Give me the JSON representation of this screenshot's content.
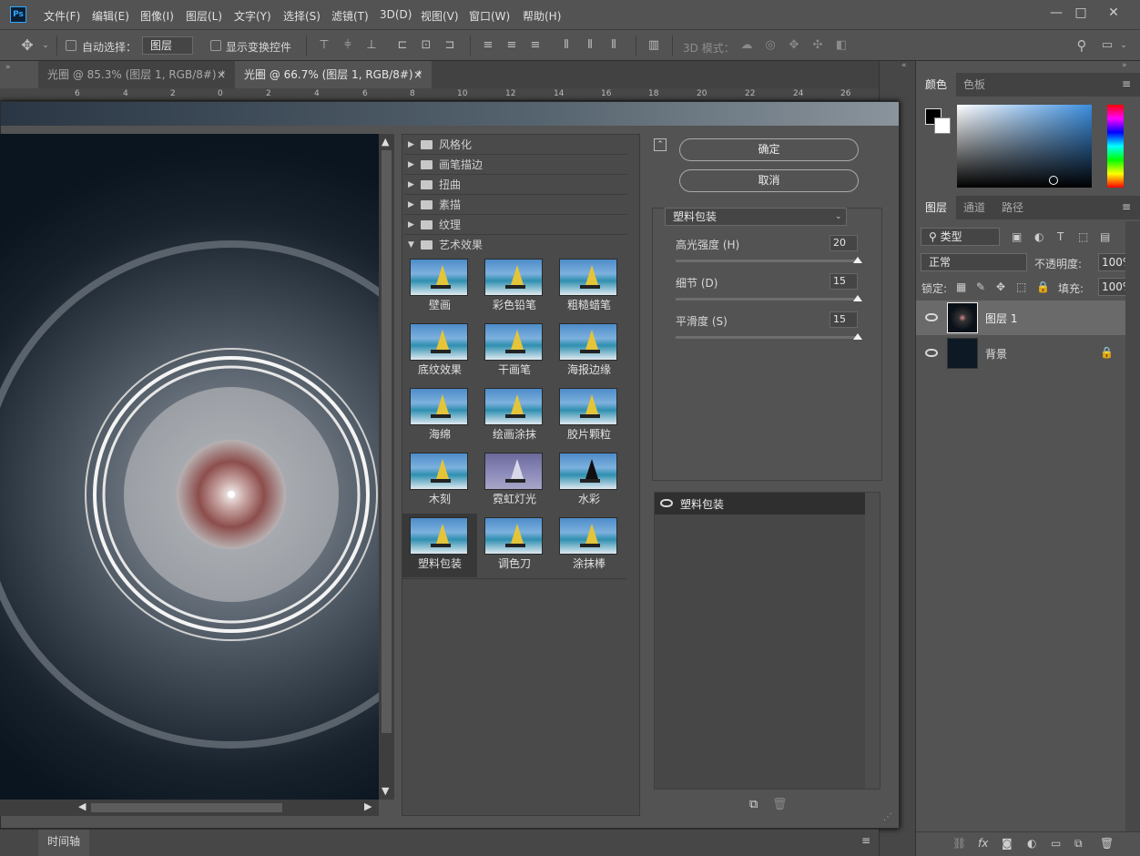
{
  "app": {
    "logo": "Ps"
  },
  "menu": [
    "文件(F)",
    "编辑(E)",
    "图像(I)",
    "图层(L)",
    "文字(Y)",
    "选择(S)",
    "滤镜(T)",
    "3D(D)",
    "视图(V)",
    "窗口(W)",
    "帮助(H)"
  ],
  "window_controls": {
    "minimize": "—",
    "restore": "□",
    "close": "✕"
  },
  "options": {
    "auto_select_label": "自动选择：",
    "auto_select_value": "图层",
    "show_transform_label": "显示变换控件",
    "mode_3d_label": "3D 模式："
  },
  "tabs": [
    {
      "label": "光圈 @ 85.3% (图层 1, RGB/8#) *",
      "close": "×"
    },
    {
      "label": "光圈 @ 66.7% (图层 1, RGB/8#) *",
      "close": "×"
    }
  ],
  "ruler": [
    "6",
    "4",
    "2",
    "0",
    "2",
    "4",
    "6",
    "8",
    "10",
    "12",
    "14",
    "16",
    "18",
    "20",
    "22",
    "24",
    "26"
  ],
  "filter_gallery": {
    "categories": [
      {
        "label": "风格化",
        "expanded": false
      },
      {
        "label": "画笔描边",
        "expanded": false
      },
      {
        "label": "扭曲",
        "expanded": false
      },
      {
        "label": "素描",
        "expanded": false
      },
      {
        "label": "纹理",
        "expanded": false
      },
      {
        "label": "艺术效果",
        "expanded": true
      }
    ],
    "thumbnails": [
      "壁画",
      "彩色铅笔",
      "粗糙蜡笔",
      "底纹效果",
      "干画笔",
      "海报边缘",
      "海绵",
      "绘画涂抹",
      "胶片颗粒",
      "木刻",
      "霓虹灯光",
      "水彩",
      "塑料包装",
      "调色刀",
      "涂抹棒"
    ],
    "selected": "塑料包装",
    "ok_label": "确定",
    "cancel_label": "取消",
    "filter_select": "塑料包装",
    "params": [
      {
        "label": "高光强度 (H)",
        "value": "20",
        "fraction": 1.0
      },
      {
        "label": "细节 (D)",
        "value": "15",
        "fraction": 1.0
      },
      {
        "label": "平滑度 (S)",
        "value": "15",
        "fraction": 1.0
      }
    ],
    "applied_layer": "塑料包装"
  },
  "right_panels": {
    "color_tabs": [
      "颜色",
      "色板"
    ],
    "layer_tabs": [
      "图层",
      "通道",
      "路径"
    ],
    "filter_kind": "类型",
    "blend_mode": "正常",
    "opacity_label": "不透明度:",
    "opacity_value": "100%",
    "lock_label": "锁定:",
    "fill_label": "填充:",
    "fill_value": "100%",
    "layers": [
      {
        "name": "图层 1",
        "selected": true,
        "locked": false
      },
      {
        "name": "背景",
        "selected": false,
        "locked": true
      }
    ]
  },
  "status": {
    "timeline": "时间轴"
  }
}
